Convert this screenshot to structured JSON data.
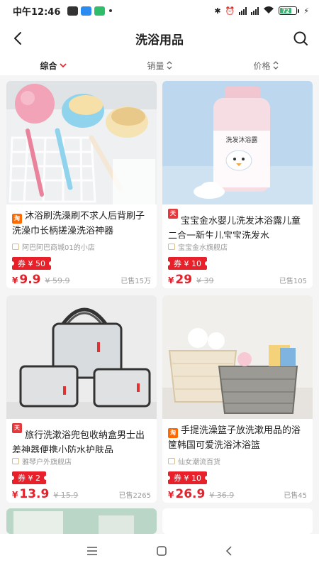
{
  "status": {
    "time": "中午12:46",
    "battery": "72"
  },
  "header": {
    "title": "洗浴用品",
    "back_icon": "back-arrow-icon",
    "search_icon": "search-icon"
  },
  "sort": {
    "items": [
      {
        "label": "综合",
        "active": true
      },
      {
        "label": "销量",
        "active": false
      },
      {
        "label": "价格",
        "active": false
      }
    ]
  },
  "products": [
    {
      "title": "沐浴刷洗澡刷不求人后背刷子洗澡巾长柄搓澡洗浴神器",
      "platform": "taobao",
      "platform_text": "淘",
      "shop": "阿巴阿巴商城01的小店",
      "coupon": "券 ¥ 50",
      "price": "9.9",
      "original_price": "¥ 59.9",
      "sold": "已售15万"
    },
    {
      "title": "宝宝金水婴儿洗发沐浴露儿童二合一新生儿宝宝洗发水",
      "platform": "tmall",
      "platform_text": "天猫",
      "shop": "宝宝金水旗舰店",
      "coupon": "券 ¥ 10",
      "price": "29",
      "original_price": "¥ 39",
      "sold": "已售105"
    },
    {
      "title": "旅行洗漱浴兜包收纳盒男士出差神器便携小防水护肤品",
      "platform": "tmall",
      "platform_text": "天猫",
      "shop": "雅琴户外旗舰店",
      "coupon": "券 ¥ 2",
      "price": "13.9",
      "original_price": "¥ 15.9",
      "sold": "已售2265"
    },
    {
      "title": "手提洗澡篮子放洗漱用品的浴筐韩国可爱洗浴沐浴篮",
      "platform": "taobao",
      "platform_text": "淘",
      "shop": "仙女潮流百货",
      "coupon": "券 ¥ 10",
      "price": "26.9",
      "original_price": "¥ 36.9",
      "sold": "已售45"
    }
  ],
  "product_bottle_label": "洗发沐浴露",
  "colors": {
    "accent": "#e8202a",
    "taobao": "#ff6a00",
    "tmall": "#e4393c"
  }
}
